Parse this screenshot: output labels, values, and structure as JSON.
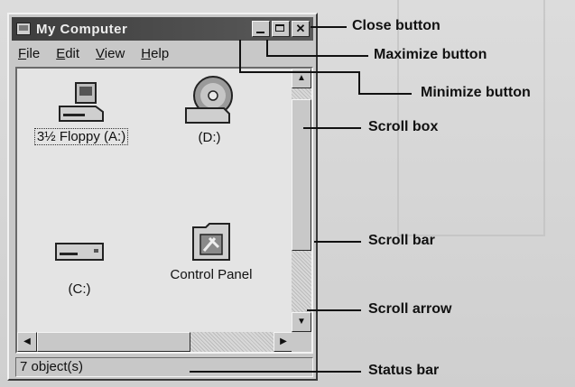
{
  "window": {
    "title": "My Computer",
    "menu": [
      "File",
      "Edit",
      "View",
      "Help"
    ],
    "items": [
      {
        "label": "3½ Floppy (A:)",
        "icon": "floppy-drive-icon",
        "selected": true
      },
      {
        "label": "(D:)",
        "icon": "cd-drive-icon",
        "selected": false
      },
      {
        "label": "(C:)",
        "icon": "hard-drive-icon",
        "selected": false
      },
      {
        "label": "Control Panel",
        "icon": "control-panel-folder-icon",
        "selected": false
      }
    ],
    "status": "7 object(s)"
  },
  "callouts": {
    "close": "Close button",
    "maximize": "Maximize button",
    "minimize": "Minimize button",
    "scroll_box": "Scroll box",
    "scroll_bar": "Scroll bar",
    "scroll_arrow": "Scroll arrow",
    "status_bar": "Status bar"
  }
}
